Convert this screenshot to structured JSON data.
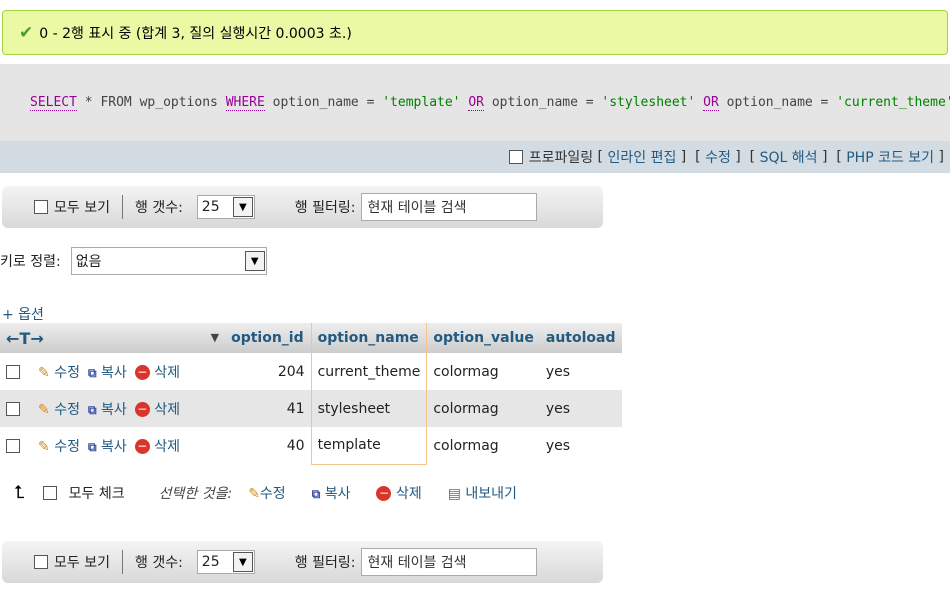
{
  "message": {
    "text": "0 - 2행 표시 중 (합계 3, 질의 실행시간 0.0003 초.)"
  },
  "sql": {
    "parts": [
      {
        "t": "SELECT",
        "c": "kw"
      },
      {
        "t": " * ",
        "c": ""
      },
      {
        "t": "FROM",
        "c": ""
      },
      {
        "t": " wp_options ",
        "c": ""
      },
      {
        "t": "WHERE",
        "c": "kw"
      },
      {
        "t": " option_name = ",
        "c": ""
      },
      {
        "t": "'template'",
        "c": "str"
      },
      {
        "t": " ",
        "c": ""
      },
      {
        "t": "OR",
        "c": "kw"
      },
      {
        "t": " option_name = ",
        "c": ""
      },
      {
        "t": "'stylesheet'",
        "c": "str"
      },
      {
        "t": " ",
        "c": ""
      },
      {
        "t": "OR",
        "c": "kw"
      },
      {
        "t": " option_name = ",
        "c": ""
      },
      {
        "t": "'current_theme'",
        "c": "str"
      }
    ]
  },
  "sql_links": {
    "profiling": "프로파일링",
    "inline_edit": "인라인 편집",
    "edit": "수정",
    "explain": "SQL 해석",
    "php_code": "PHP 코드 보기"
  },
  "nav": {
    "show_all": "모두 보기",
    "rows_label": "행 갯수:",
    "rows_value": "25",
    "filter_label": "행 필터링:",
    "filter_placeholder": "현재 테이블 검색"
  },
  "sort": {
    "label": "키로 정렬:",
    "value": "없음"
  },
  "options_link": "+ 옵션",
  "table": {
    "arrows": "←T→",
    "columns": [
      "option_id",
      "option_name",
      "option_value",
      "autoload"
    ],
    "actions": {
      "edit": "수정",
      "copy": "복사",
      "delete": "삭제"
    },
    "rows": [
      [
        "204",
        "current_theme",
        "colormag",
        "yes"
      ],
      [
        "41",
        "stylesheet",
        "colormag",
        "yes"
      ],
      [
        "40",
        "template",
        "colormag",
        "yes"
      ]
    ]
  },
  "bulk": {
    "check_all": "모두 체크",
    "with_selected": "선택한 것을:",
    "edit": "수정",
    "copy": "복사",
    "delete": "삭제",
    "export": "내보내기"
  },
  "colors": {
    "accent": "#235a81",
    "success_bg": "#ebf8a4",
    "sql_bg": "#e5e5e5"
  }
}
